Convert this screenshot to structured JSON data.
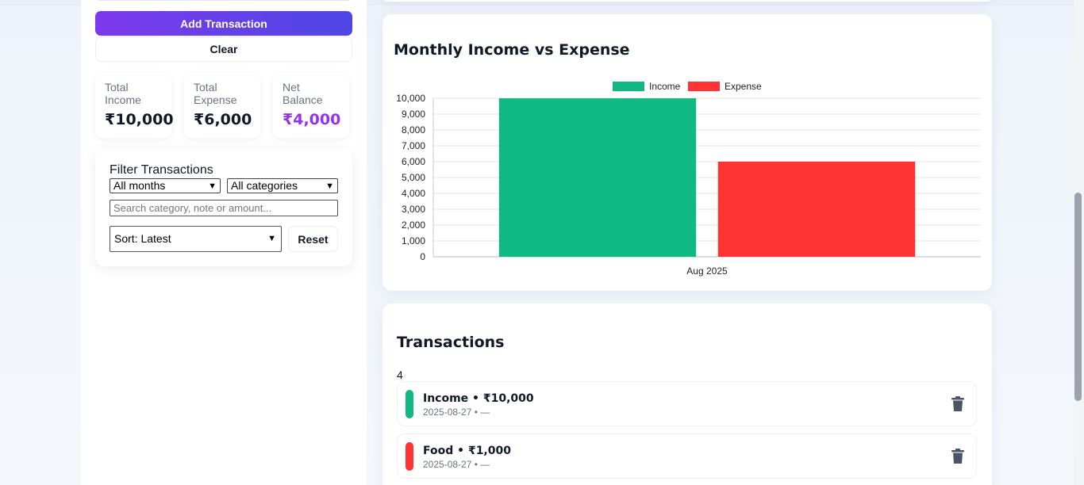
{
  "sidebar": {
    "add_label": "Add Transaction",
    "clear_label": "Clear",
    "stats": {
      "income_label": "Total Income",
      "income_value": "₹10,000",
      "expense_label": "Total Expense",
      "expense_value": "₹6,000",
      "net_label": "Net Balance",
      "net_value": "₹4,000"
    },
    "filter": {
      "title": "Filter Transactions",
      "month_value": "All months",
      "category_value": "All categories",
      "search_placeholder": "Search category, note or amount...",
      "sort_value": "Sort: Latest",
      "reset_label": "Reset"
    }
  },
  "chart_section": {
    "title": "Monthly Income vs Expense"
  },
  "chart_data": {
    "type": "bar",
    "title": "Monthly Income vs Expense",
    "categories": [
      "Aug 2025"
    ],
    "series": [
      {
        "name": "Income",
        "values": [
          10000
        ],
        "color": "#10b981"
      },
      {
        "name": "Expense",
        "values": [
          6000
        ],
        "color": "#ff3333"
      }
    ],
    "ylim": [
      0,
      10000
    ],
    "yticks": [
      "0",
      "1,000",
      "2,000",
      "3,000",
      "4,000",
      "5,000",
      "6,000",
      "7,000",
      "8,000",
      "9,000",
      "10,000"
    ],
    "grid": true,
    "legend": "top-center"
  },
  "transactions": {
    "title": "Transactions",
    "count": "4",
    "items": [
      {
        "title": "Income • ₹10,000",
        "meta": "2025-08-27 • —",
        "color": "#10b981"
      },
      {
        "title": "Food • ₹1,000",
        "meta": "2025-08-27 • —",
        "color": "#ff3333"
      }
    ]
  }
}
